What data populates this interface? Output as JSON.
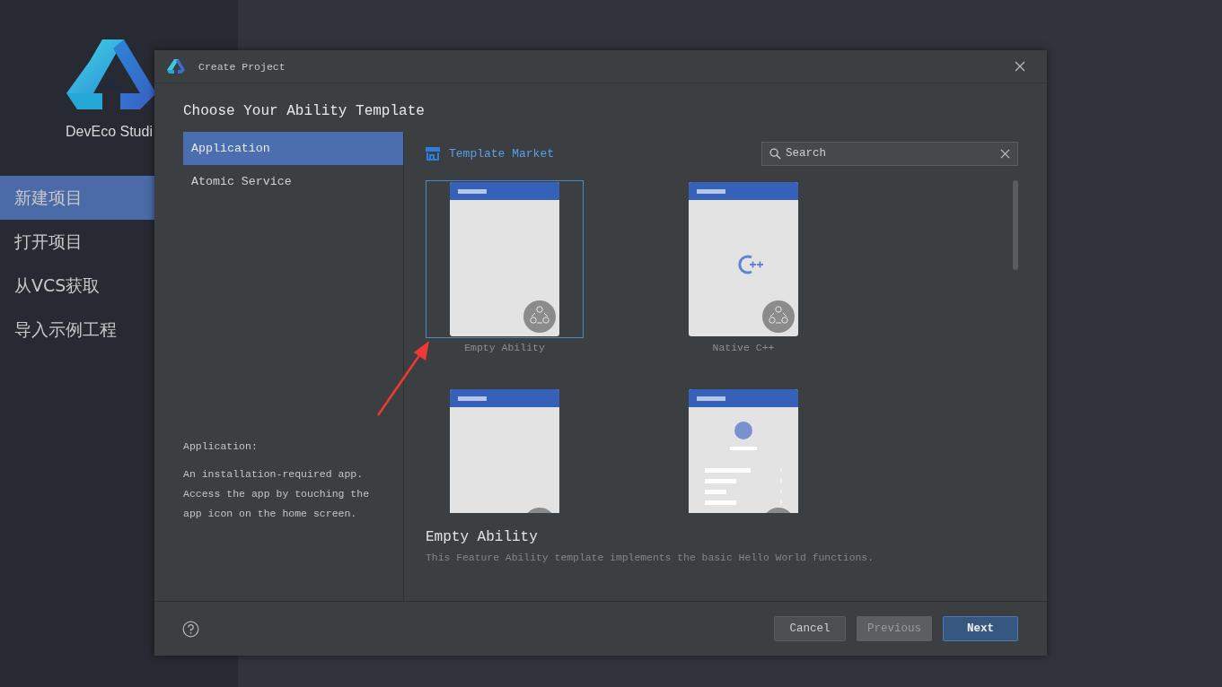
{
  "sidebar": {
    "app_name": "DevEco Studi",
    "items": [
      {
        "label": "新建项目",
        "selected": true
      },
      {
        "label": "打开项目",
        "selected": false
      },
      {
        "label": "从VCS获取",
        "selected": false
      },
      {
        "label": "导入示例工程",
        "selected": false
      }
    ]
  },
  "dialog": {
    "title": "Create Project",
    "heading": "Choose Your Ability Template",
    "categories": [
      {
        "label": "Application",
        "selected": true
      },
      {
        "label": "Atomic Service",
        "selected": false
      }
    ],
    "category_info": {
      "title": "Application:",
      "text": "An installation-required app. Access the app by touching the app icon on the home screen."
    },
    "template_market": "Template Market",
    "search": {
      "placeholder": "Search"
    },
    "templates": [
      {
        "kind": "empty",
        "name": "Empty Ability",
        "selected": true
      },
      {
        "kind": "cpp",
        "name": "Native C++",
        "selected": false
      },
      {
        "kind": "empty",
        "selected": false
      },
      {
        "kind": "list",
        "selected": false
      }
    ],
    "selected_template": {
      "name": "Empty Ability",
      "description": "This Feature Ability template implements the basic Hello World functions."
    },
    "buttons": [
      {
        "label": "Cancel",
        "kind": "cancel",
        "disabled": false
      },
      {
        "label": "Previous",
        "kind": "previous",
        "disabled": true
      },
      {
        "label": "Next",
        "kind": "next",
        "disabled": false
      }
    ]
  }
}
